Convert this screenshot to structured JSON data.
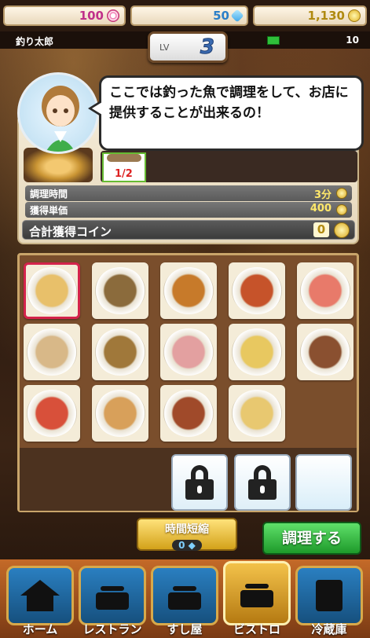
{
  "currency": {
    "hearts": "100",
    "gems": "50",
    "coins": "1,130"
  },
  "player": {
    "name": "釣り太郎",
    "level_label": "LV",
    "level": "3",
    "exp_count": "10"
  },
  "speech": {
    "text": "ここでは釣った魚で調理をして、お店に提供することが出来るの！"
  },
  "recipe": {
    "ingredient_ratio": "1/2",
    "cook_time_label": "調理時間",
    "cook_time_value": "3分",
    "unit_price_label": "獲得単価",
    "unit_price_value": "400",
    "total_label": "合計獲得コイン",
    "total_value": "0"
  },
  "dishes": [
    {
      "name": "gyoza",
      "color": "#e8c06a"
    },
    {
      "name": "stew",
      "color": "#8b6b3c"
    },
    {
      "name": "curry",
      "color": "#c77a2a"
    },
    {
      "name": "paella",
      "color": "#c6532a"
    },
    {
      "name": "salmon",
      "color": "#e87a6a"
    },
    {
      "name": "soup-bowl",
      "color": "#d8b888"
    },
    {
      "name": "grilled-fish",
      "color": "#a0783a"
    },
    {
      "name": "sashimi-plate",
      "color": "#e3a0a0"
    },
    {
      "name": "tempura",
      "color": "#e8c860"
    },
    {
      "name": "shrimp-dish",
      "color": "#8a5030"
    },
    {
      "name": "crab",
      "color": "#d8503a"
    },
    {
      "name": "fried-rice",
      "color": "#d8a05a"
    },
    {
      "name": "tofu-dish",
      "color": "#a04a2a"
    },
    {
      "name": "fried-fish",
      "color": "#e8c870"
    }
  ],
  "buttons": {
    "shorten_label": "時間短縮",
    "shorten_cost": "0",
    "cook_label": "調理する"
  },
  "nav": {
    "items": [
      {
        "label": "ホーム"
      },
      {
        "label": "レストラン"
      },
      {
        "label": "すし屋"
      },
      {
        "label": "ビストロ"
      },
      {
        "label": "冷蔵庫"
      }
    ]
  }
}
